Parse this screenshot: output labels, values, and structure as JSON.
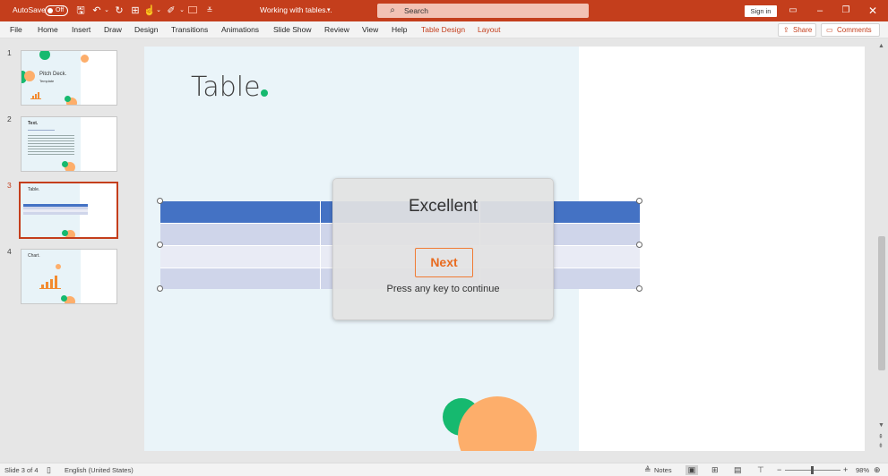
{
  "titlebar": {
    "autosave_label": "AutoSave",
    "autosave_state": "Off",
    "doc_title": "Working with tables...",
    "search_placeholder": "Search",
    "signin_label": "Sign in"
  },
  "ribbon": {
    "tabs": [
      "File",
      "Home",
      "Insert",
      "Draw",
      "Design",
      "Transitions",
      "Animations",
      "Slide Show",
      "Review",
      "View",
      "Help",
      "Table Design",
      "Layout"
    ],
    "share_label": "Share",
    "comments_label": "Comments"
  },
  "thumbnails": [
    {
      "num": "1",
      "title": "Pitch Deck.",
      "subtitle": "Template"
    },
    {
      "num": "2",
      "title": "Text."
    },
    {
      "num": "3",
      "title": "Table."
    },
    {
      "num": "4",
      "title": "Chart."
    }
  ],
  "slide": {
    "title": "Table"
  },
  "dialog": {
    "title": "Excellent",
    "next_label": "Next",
    "hint": "Press any key to continue"
  },
  "statusbar": {
    "slide_info": "Slide 3 of 4",
    "language": "English (United States)",
    "notes_label": "Notes",
    "zoom": "98%"
  },
  "colors": {
    "accent": "#c43e1c",
    "table_header": "#4472c4",
    "table_row_dark": "#cfd5ea",
    "table_row_light": "#e9ebf5",
    "dot_green": "#16b96f",
    "circle_orange": "#fdae6b"
  }
}
